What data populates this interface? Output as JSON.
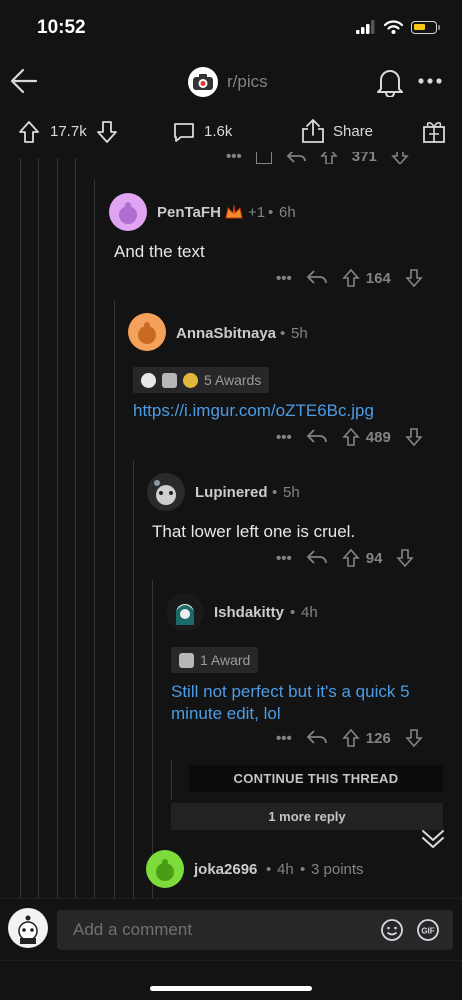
{
  "status": {
    "time": "10:52"
  },
  "header": {
    "subreddit": "r/pics"
  },
  "post_actions": {
    "upvotes": "17.7k",
    "comments": "1.6k",
    "share": "Share"
  },
  "partial_row": {
    "score": "371"
  },
  "comments": [
    {
      "user": "PenTaFH",
      "flair": "+1",
      "age": "6h",
      "text": "And the text",
      "score": "164"
    },
    {
      "user": "AnnaSbitnaya",
      "age": "5h",
      "awards": "5 Awards",
      "link": "https://i.imgur.com/oZTE6Bc.jpg",
      "score": "489"
    },
    {
      "user": "Lupinered",
      "age": "5h",
      "text": "That lower left one is cruel.",
      "score": "94"
    },
    {
      "user": "Ishdakitty",
      "age": "4h",
      "awards": "1 Award",
      "link_line1": "Still not perfect but it's a quick 5",
      "link_line2": "minute edit, lol",
      "score": "126"
    }
  ],
  "continue_thread": "CONTINUE THIS THREAD",
  "more_replies": "1 more reply",
  "last_comment": {
    "user": "joka2696",
    "age": "4h",
    "points": "3 points"
  },
  "composer": {
    "placeholder": "Add a comment"
  },
  "colors": {
    "background": "#131313",
    "link": "#4c9ce6",
    "muted": "#818384",
    "thread_line": "#343536"
  }
}
